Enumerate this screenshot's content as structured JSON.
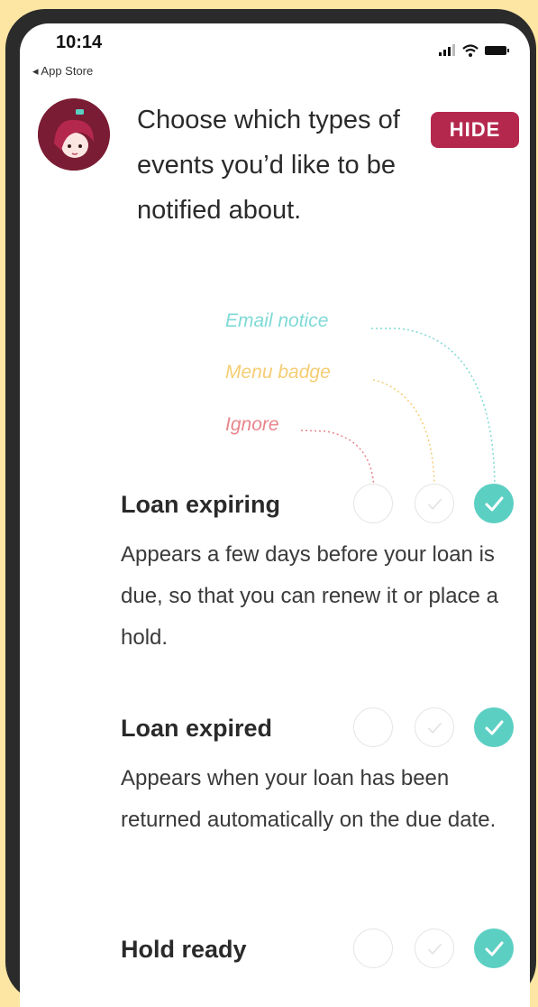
{
  "status_bar": {
    "time": "10:14",
    "back_label": "◂ App Store"
  },
  "header": {
    "intro_text": "Choose which types of events you’d like to be notified about.",
    "hide_button": "HIDE"
  },
  "legend": {
    "email": "Email notice",
    "badge": "Menu badge",
    "ignore": "Ignore"
  },
  "colors": {
    "email": "#5ccfc3",
    "badge": "#f5cd73",
    "ignore": "#e8858c",
    "brand": "#b5284e"
  },
  "items": [
    {
      "title": "Loan expiring",
      "description": "Appears a few days before your loan is due, so that you can renew it or place a hold.",
      "selected": "email"
    },
    {
      "title": "Loan expired",
      "description": "Appears when your loan has been returned automatically on the due date.",
      "selected": "email"
    },
    {
      "title": "Hold ready",
      "description": "",
      "selected": "email"
    }
  ]
}
